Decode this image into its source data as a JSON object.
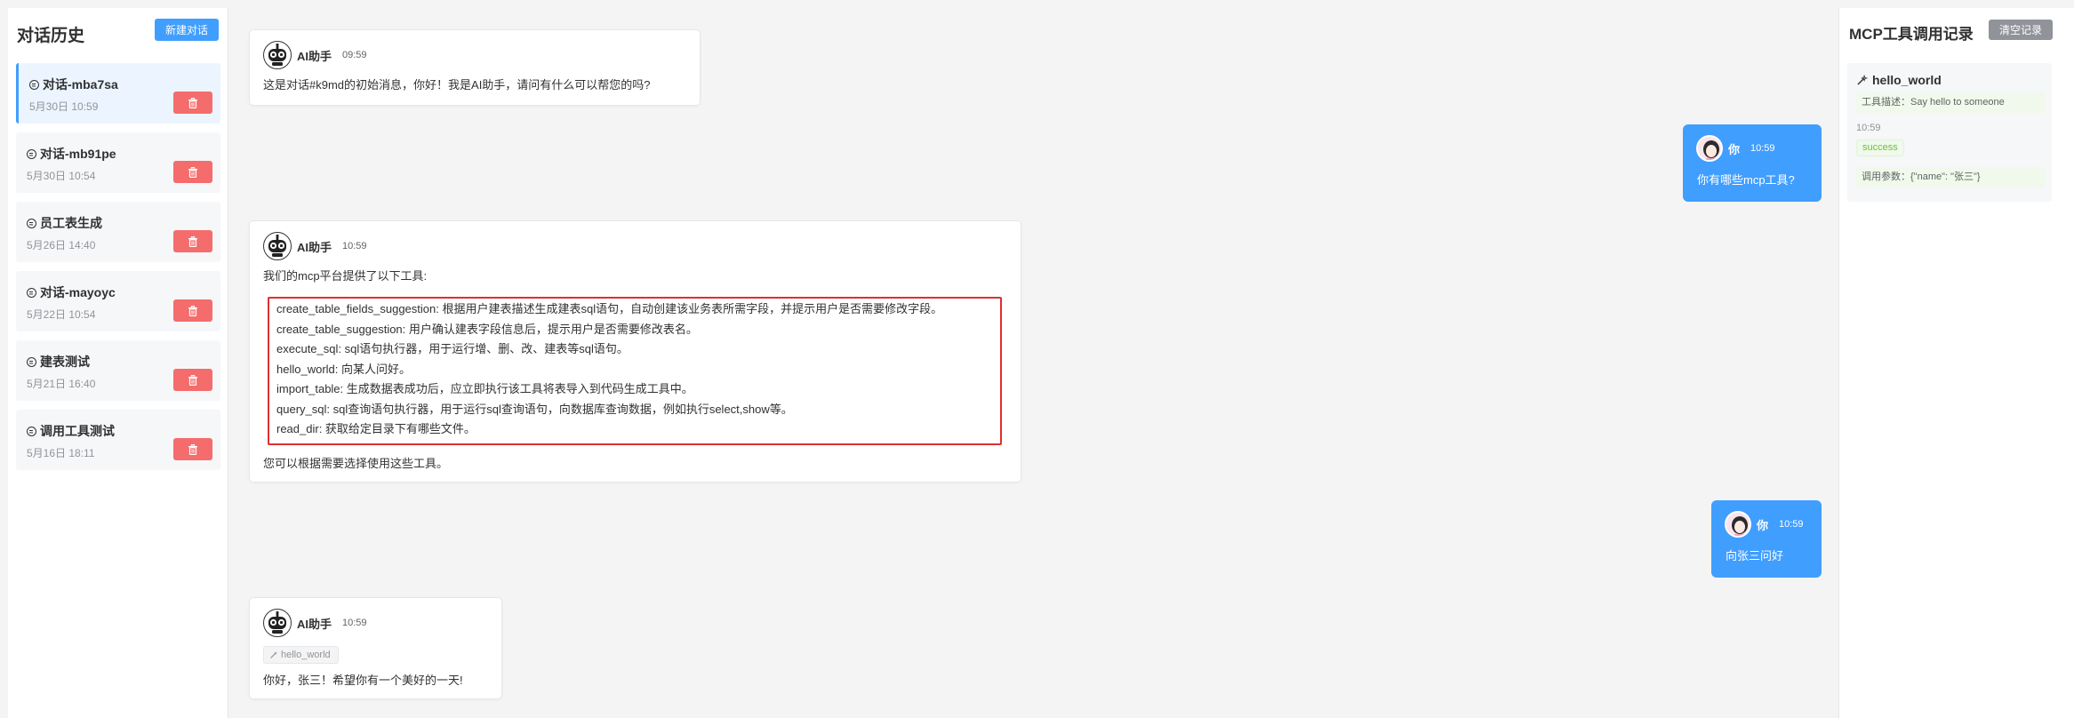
{
  "sidebar": {
    "title": "对话历史",
    "new_button": "新建对话",
    "items": [
      {
        "title": "对话-mba7sa",
        "time": "5月30日 10:59"
      },
      {
        "title": "对话-mb91pe",
        "time": "5月30日 10:54"
      },
      {
        "title": "员工表生成",
        "time": "5月26日 14:40"
      },
      {
        "title": "对话-mayoyc",
        "time": "5月22日 10:54"
      },
      {
        "title": "建表测试",
        "time": "5月21日 16:40"
      },
      {
        "title": "调用工具测试",
        "time": "5月16日 18:11"
      }
    ]
  },
  "chat": {
    "ai_name": "AI助手",
    "user_name": "你",
    "messages": [
      {
        "time": "09:59",
        "text": "这是对话#k9md的初始消息，你好！我是AI助手，请问有什么可以帮您的吗?"
      },
      {
        "time": "10:59",
        "text": "你有哪些mcp工具?"
      },
      {
        "time": "10:59",
        "intro": "我们的mcp平台提供了以下工具:",
        "tools": [
          "create_table_fields_suggestion: 根据用户建表描述生成建表sql语句，自动创建该业务表所需字段，并提示用户是否需要修改字段。",
          "create_table_suggestion: 用户确认建表字段信息后，提示用户是否需要修改表名。",
          "execute_sql: sql语句执行器，用于运行增、删、改、建表等sql语句。",
          "hello_world: 向某人问好。",
          "import_table: 生成数据表成功后，应立即执行该工具将表导入到代码生成工具中。",
          "query_sql: sql查询语句执行器，用于运行sql查询语句，向数据库查询数据，例如执行select,show等。",
          "read_dir: 获取给定目录下有哪些文件。"
        ],
        "outro": "您可以根据需要选择使用这些工具。"
      },
      {
        "time": "10:59",
        "text": "向张三问好"
      },
      {
        "time": "10:59",
        "tool_tag": "hello_world",
        "text": "你好，张三！希望你有一个美好的一天!"
      }
    ]
  },
  "panel": {
    "title": "MCP工具调用记录",
    "clear_button": "清空记录",
    "records": [
      {
        "tool": "hello_world",
        "desc": "工具描述：Say hello to someone",
        "time": "10:59",
        "status": "success",
        "params": "调用参数：{\"name\": \"张三\"}"
      }
    ]
  },
  "colors": {
    "primary": "#409eff",
    "danger": "#f56c6c",
    "success": "#67c23a",
    "info": "#909399",
    "highlight_border": "#e02f2f"
  }
}
